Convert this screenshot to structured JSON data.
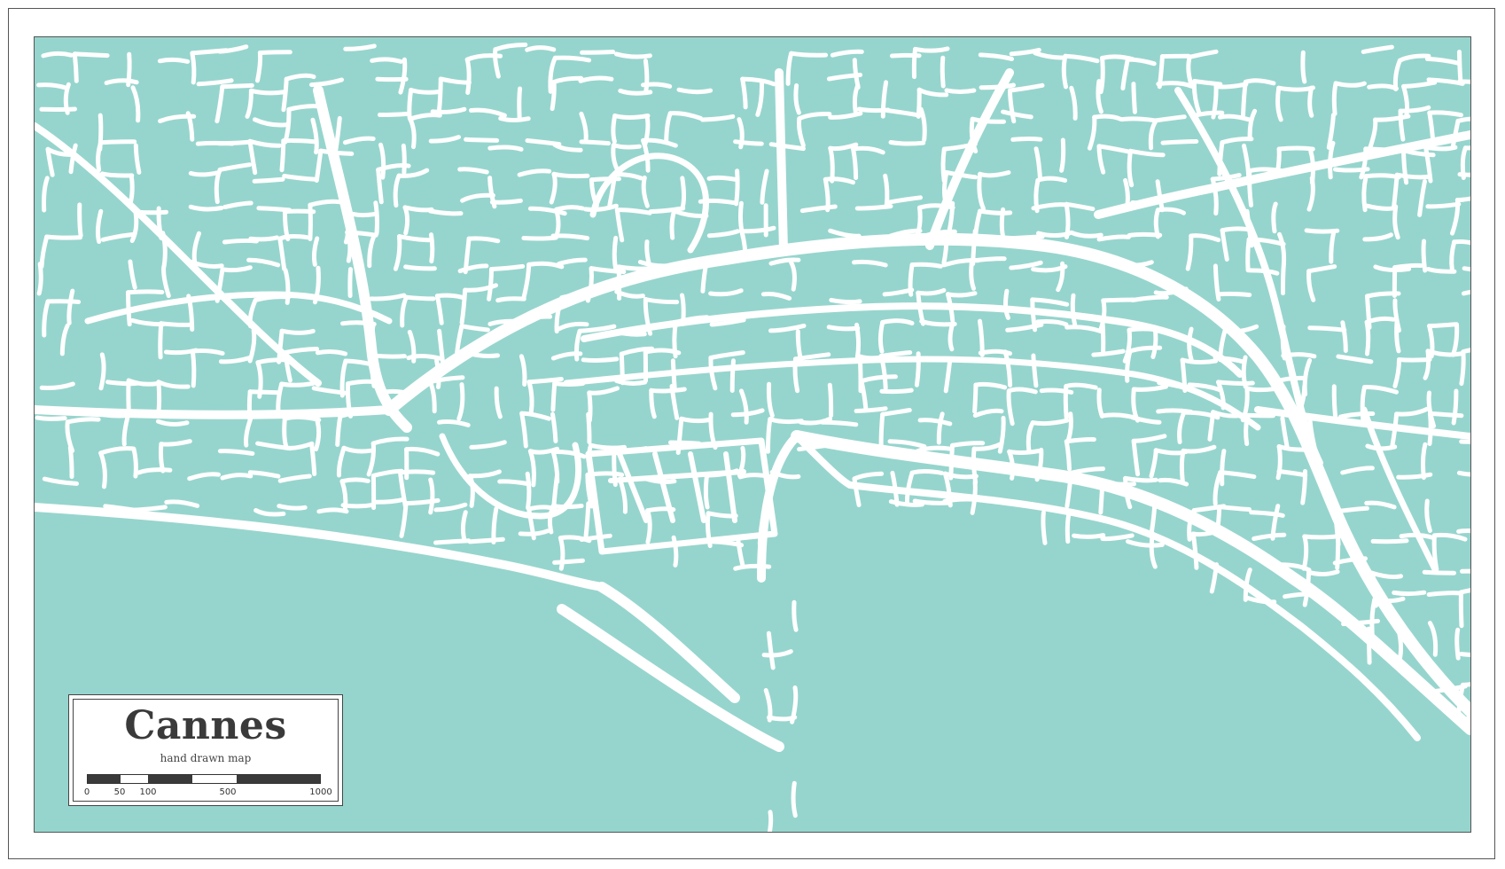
{
  "map": {
    "title": "Cannes",
    "subtitle": "hand drawn map",
    "colors": {
      "land": "#96d5cd",
      "water": "#96d5cd",
      "roads": "#ffffff",
      "frame": "#555555",
      "text": "#3a3a3a"
    },
    "scale": {
      "labels": [
        "0",
        "50",
        "100",
        "500",
        "1000"
      ],
      "segment_colors": [
        "#3a3a3a",
        "#ffffff",
        "#3a3a3a",
        "#ffffff",
        "#3a3a3a"
      ]
    }
  }
}
